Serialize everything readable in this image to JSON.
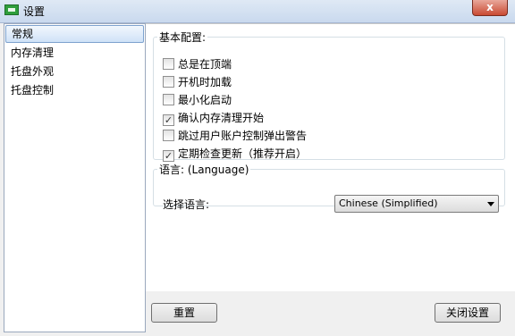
{
  "window": {
    "title": "设置",
    "close_glyph": "x"
  },
  "sidebar": {
    "items": [
      {
        "label": "常规",
        "selected": true
      },
      {
        "label": "内存清理",
        "selected": false
      },
      {
        "label": "托盘外观",
        "selected": false
      },
      {
        "label": "托盘控制",
        "selected": false
      }
    ]
  },
  "basic": {
    "legend": "基本配置:",
    "options": [
      {
        "label": "总是在顶端",
        "checked": false
      },
      {
        "label": "开机时加载",
        "checked": false
      },
      {
        "label": "最小化启动",
        "checked": false
      },
      {
        "label": "确认内存清理开始",
        "checked": true
      },
      {
        "label": "跳过用户账户控制弹出警告",
        "checked": false
      },
      {
        "label": "定期检查更新（推荐开启）",
        "checked": true
      }
    ]
  },
  "language": {
    "legend": "语言: (Language)",
    "label": "选择语言:",
    "selected": "Chinese (Simplified)"
  },
  "buttons": {
    "reset": "重置",
    "close": "关闭设置"
  }
}
